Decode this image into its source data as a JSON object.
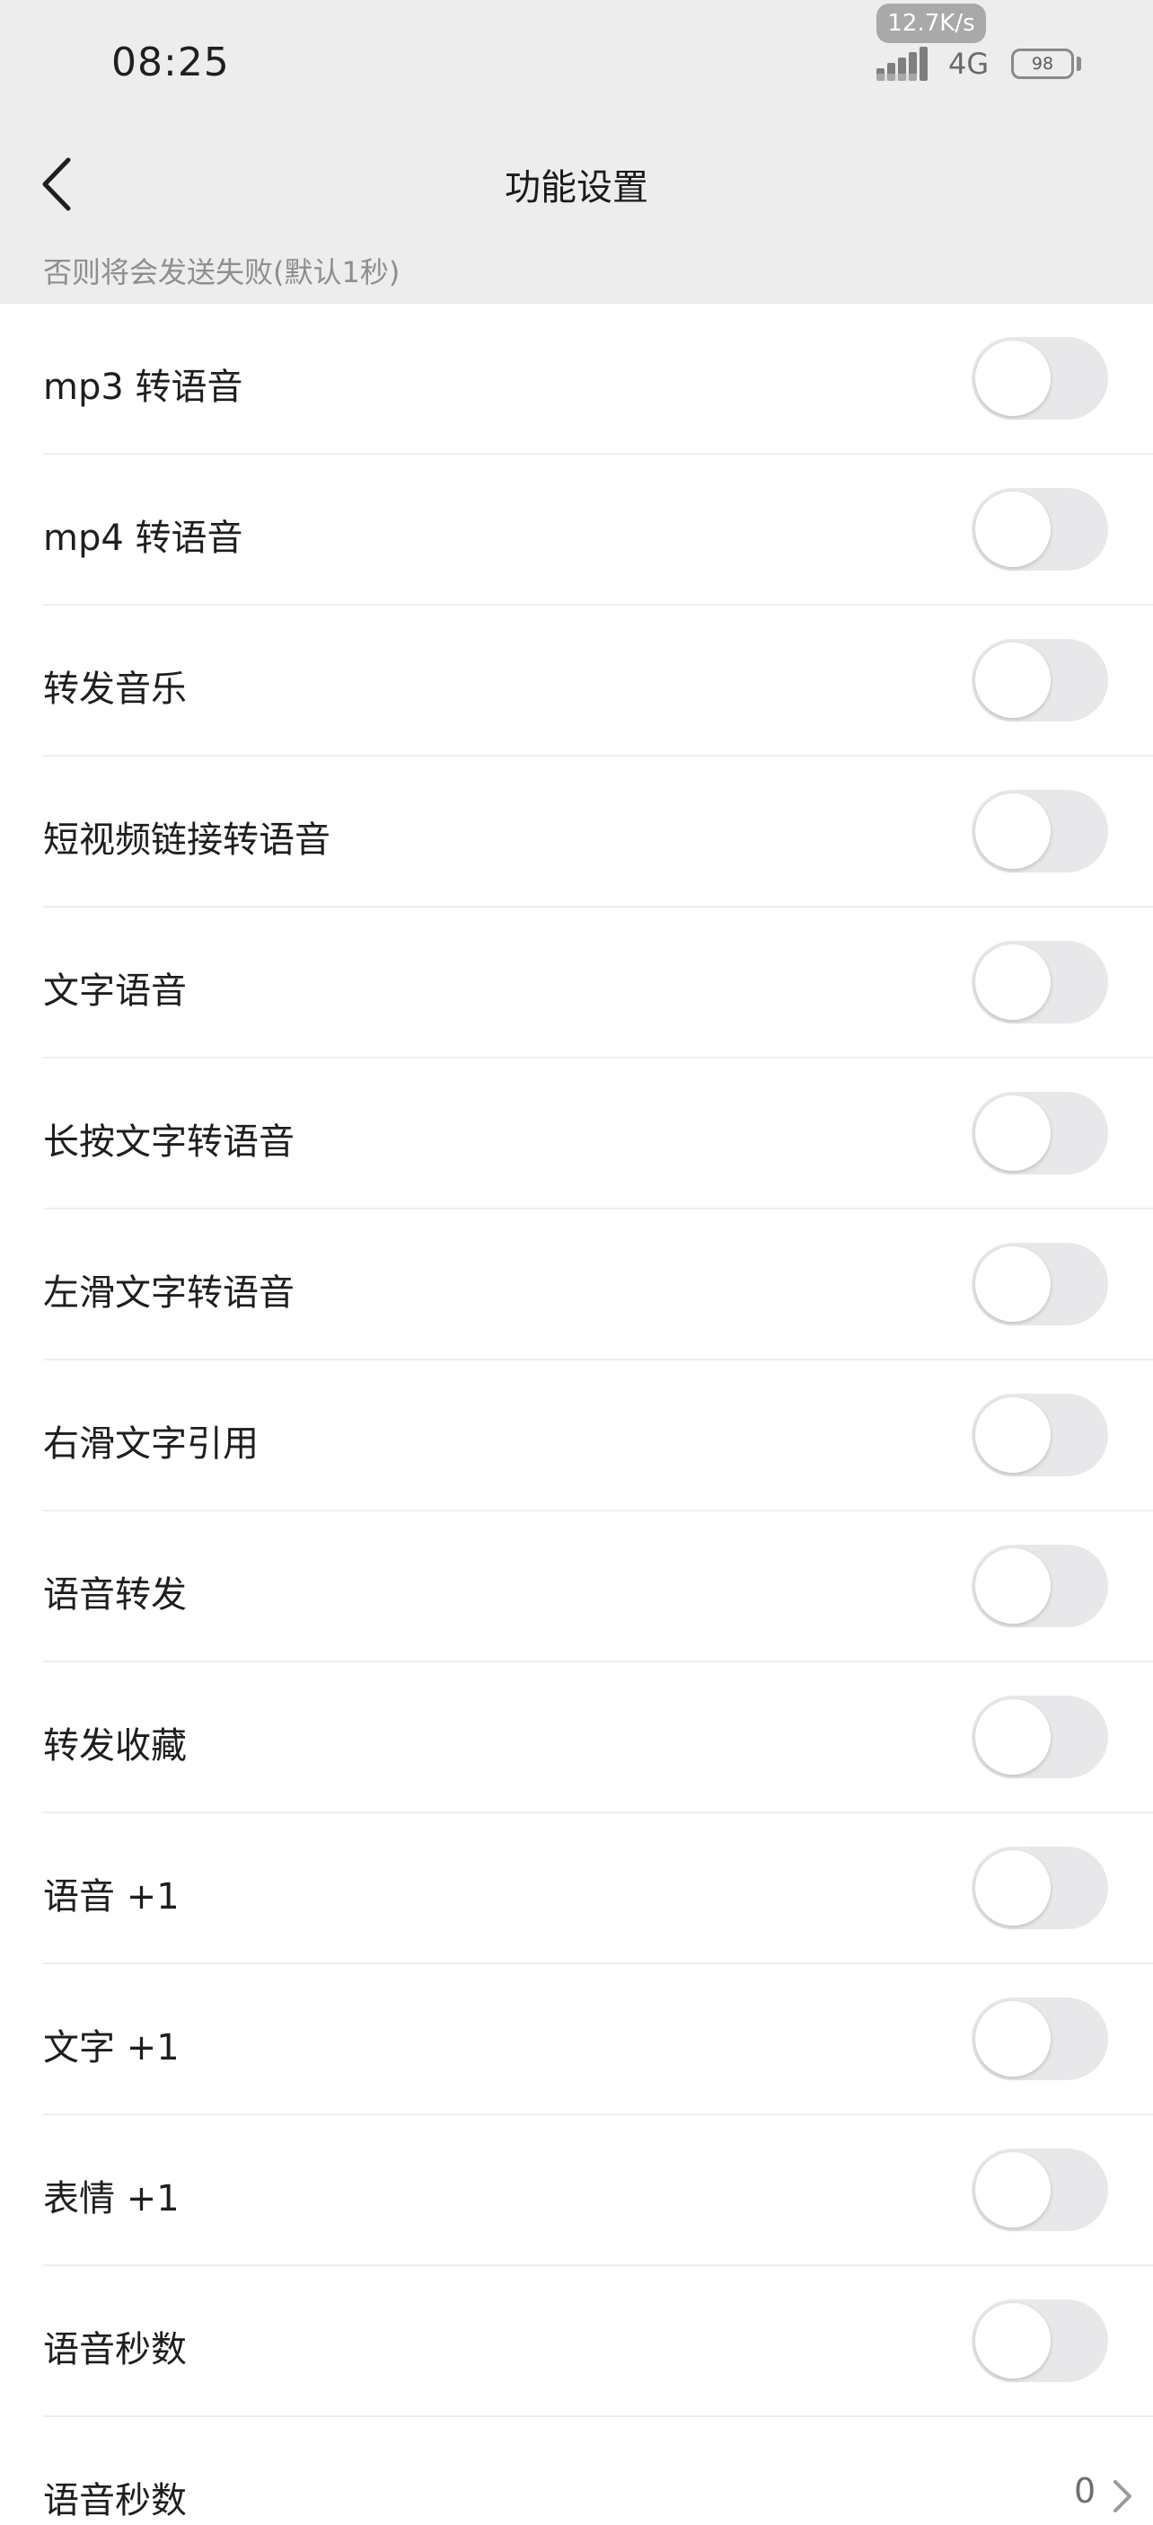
{
  "status_bar": {
    "time": "08:25",
    "net_speed": "12.7K/s",
    "network": "4G",
    "battery": "98",
    "signal_icon": "signal-bars-icon"
  },
  "header": {
    "back_icon": "chevron-left-icon",
    "title": "功能设置",
    "hint": "否则将会发送失败(默认1秒)"
  },
  "settings": [
    {
      "label": "mp3 转语音",
      "enabled": false
    },
    {
      "label": "mp4 转语音",
      "enabled": false
    },
    {
      "label": "转发音乐",
      "enabled": false
    },
    {
      "label": "短视频链接转语音",
      "enabled": false
    },
    {
      "label": "文字语音",
      "enabled": false
    },
    {
      "label": "长按文字转语音",
      "enabled": false
    },
    {
      "label": "左滑文字转语音",
      "enabled": false
    },
    {
      "label": "右滑文字引用",
      "enabled": false
    },
    {
      "label": "语音转发",
      "enabled": false
    },
    {
      "label": "转发收藏",
      "enabled": false
    },
    {
      "label": "语音 +1",
      "enabled": false
    },
    {
      "label": "文字 +1",
      "enabled": false
    },
    {
      "label": "表情 +1",
      "enabled": false
    },
    {
      "label": "语音秒数",
      "enabled": false
    }
  ],
  "value_setting": {
    "label": "语音秒数",
    "value": "0",
    "chevron_icon": "chevron-right-icon"
  },
  "colors": {
    "header_bg": "#ededed",
    "toggle_off_track": "#e8e8ea",
    "toggle_knob": "#ffffff"
  }
}
